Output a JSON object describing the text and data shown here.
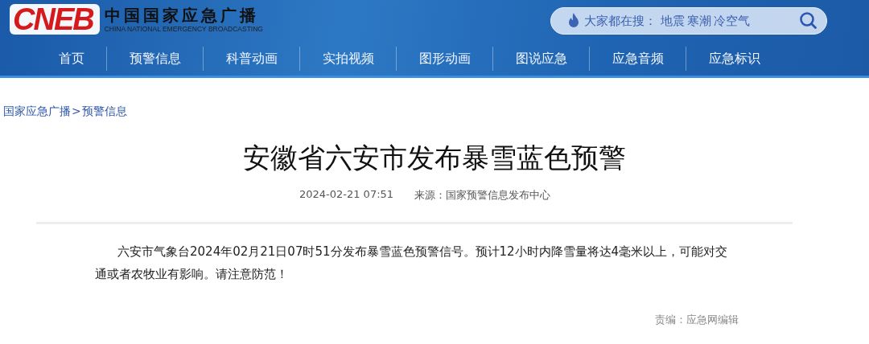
{
  "header": {
    "logo_mark": "CNEB",
    "site_name": "中国国家应急广播",
    "site_name_en": "CHINA NATIONAL EMERGENCY BROADCASTING",
    "search": {
      "label": "大家都在搜：",
      "keywords": [
        "地震",
        "寒潮",
        "冷空气"
      ]
    }
  },
  "nav": [
    {
      "label": "首页"
    },
    {
      "label": "预警信息"
    },
    {
      "label": "科普动画"
    },
    {
      "label": "实拍视频"
    },
    {
      "label": "图形动画"
    },
    {
      "label": "图说应急"
    },
    {
      "label": "应急音频"
    },
    {
      "label": "应急标识"
    }
  ],
  "breadcrumb": {
    "items": [
      "国家应急广播",
      "预警信息"
    ],
    "separator": ">"
  },
  "article": {
    "title": "安徽省六安市发布暴雪蓝色预警",
    "date": "2024-02-21 07:51",
    "source": "来源：国家预警信息发布中心",
    "body": "六安市气象台2024年02月21日07时51分发布暴雪蓝色预警信号。预计12小时内降雪量将达4毫米以上，可能对交通或者农牧业有影响。请注意防范！",
    "editor": "责编：应急网编辑"
  }
}
